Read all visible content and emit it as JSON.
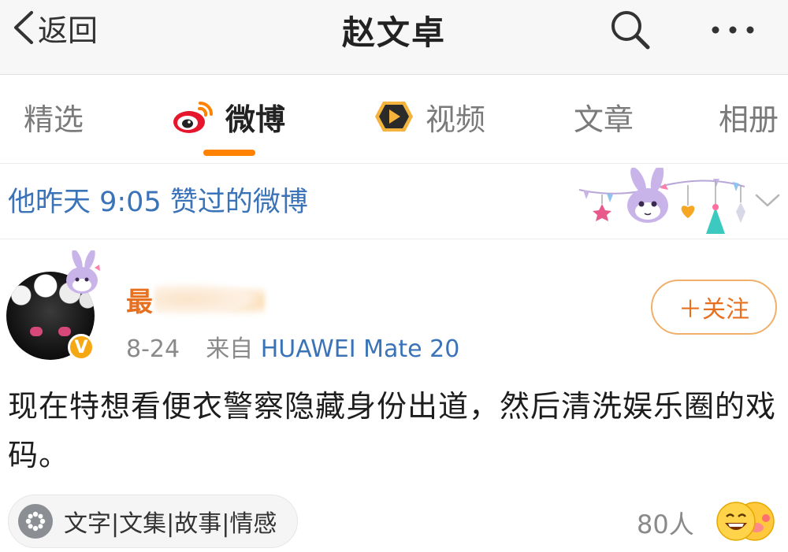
{
  "topbar": {
    "back_label": "返回",
    "title": "赵文卓",
    "icons": [
      "chevron-left-icon",
      "search-icon",
      "more-icon"
    ]
  },
  "tabs": [
    {
      "label": "精选",
      "active": false
    },
    {
      "label": "微博",
      "active": true,
      "icon": "weibo-icon"
    },
    {
      "label": "视频",
      "active": false,
      "icon": "video-play-icon"
    },
    {
      "label": "文章",
      "active": false
    },
    {
      "label": "相册",
      "active": false
    }
  ],
  "liked_header": {
    "text": "他昨天 9:05 赞过的微博",
    "icons": [
      "bunny-bunting-decoration",
      "chevron-down-icon"
    ]
  },
  "post": {
    "username_visible": "最",
    "date": "8-24",
    "source_prefix": "来自",
    "source_device": "HUAWEI Mate 20",
    "follow_label": "＋关注",
    "verified_badge": "V",
    "content": "现在特想看便衣警察隐藏身份出道，然后清洗娱乐圈的戏码。"
  },
  "topic": {
    "label": "文字|文集|故事|情感",
    "icon": "asterisk-icon"
  },
  "likes": {
    "count_text": "80人"
  },
  "colors": {
    "accent_orange": "#ff8200",
    "link_blue": "#3a73b8",
    "username_orange": "#e86f1d"
  }
}
